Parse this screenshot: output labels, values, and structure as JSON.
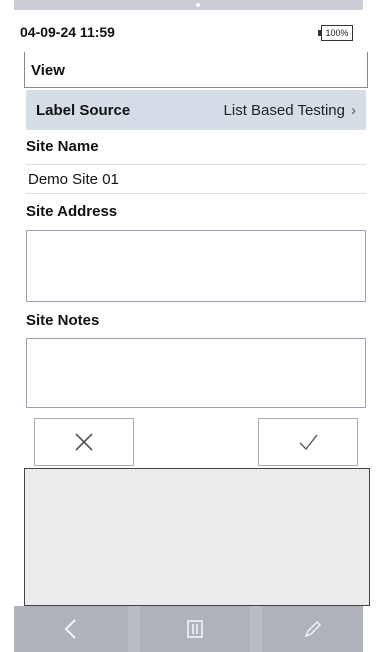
{
  "status": {
    "datetime": "04-09-24 11:59",
    "battery": "100%"
  },
  "view_label": "View",
  "label_source": {
    "key": "Label Source",
    "value": "List Based Testing",
    "chevron": "›"
  },
  "site_name": {
    "label": "Site Name",
    "value": "Demo Site 01"
  },
  "site_address": {
    "label": "Site Address",
    "value": ""
  },
  "site_notes": {
    "label": "Site Notes",
    "value": ""
  },
  "actions": {
    "cancel_glyph": "✕",
    "confirm_glyph": "✓",
    "cancel_icon": "close-icon",
    "confirm_icon": "check-icon"
  },
  "bottom_nav": [
    {
      "icon": "back-arrow-icon"
    },
    {
      "icon": "delete-icon"
    },
    {
      "icon": "edit-pencil-icon"
    }
  ],
  "colors": {
    "header_row_bg": "#d5dee7",
    "nav_bg": "#aeb2ba",
    "content_bg": "#ececec"
  }
}
